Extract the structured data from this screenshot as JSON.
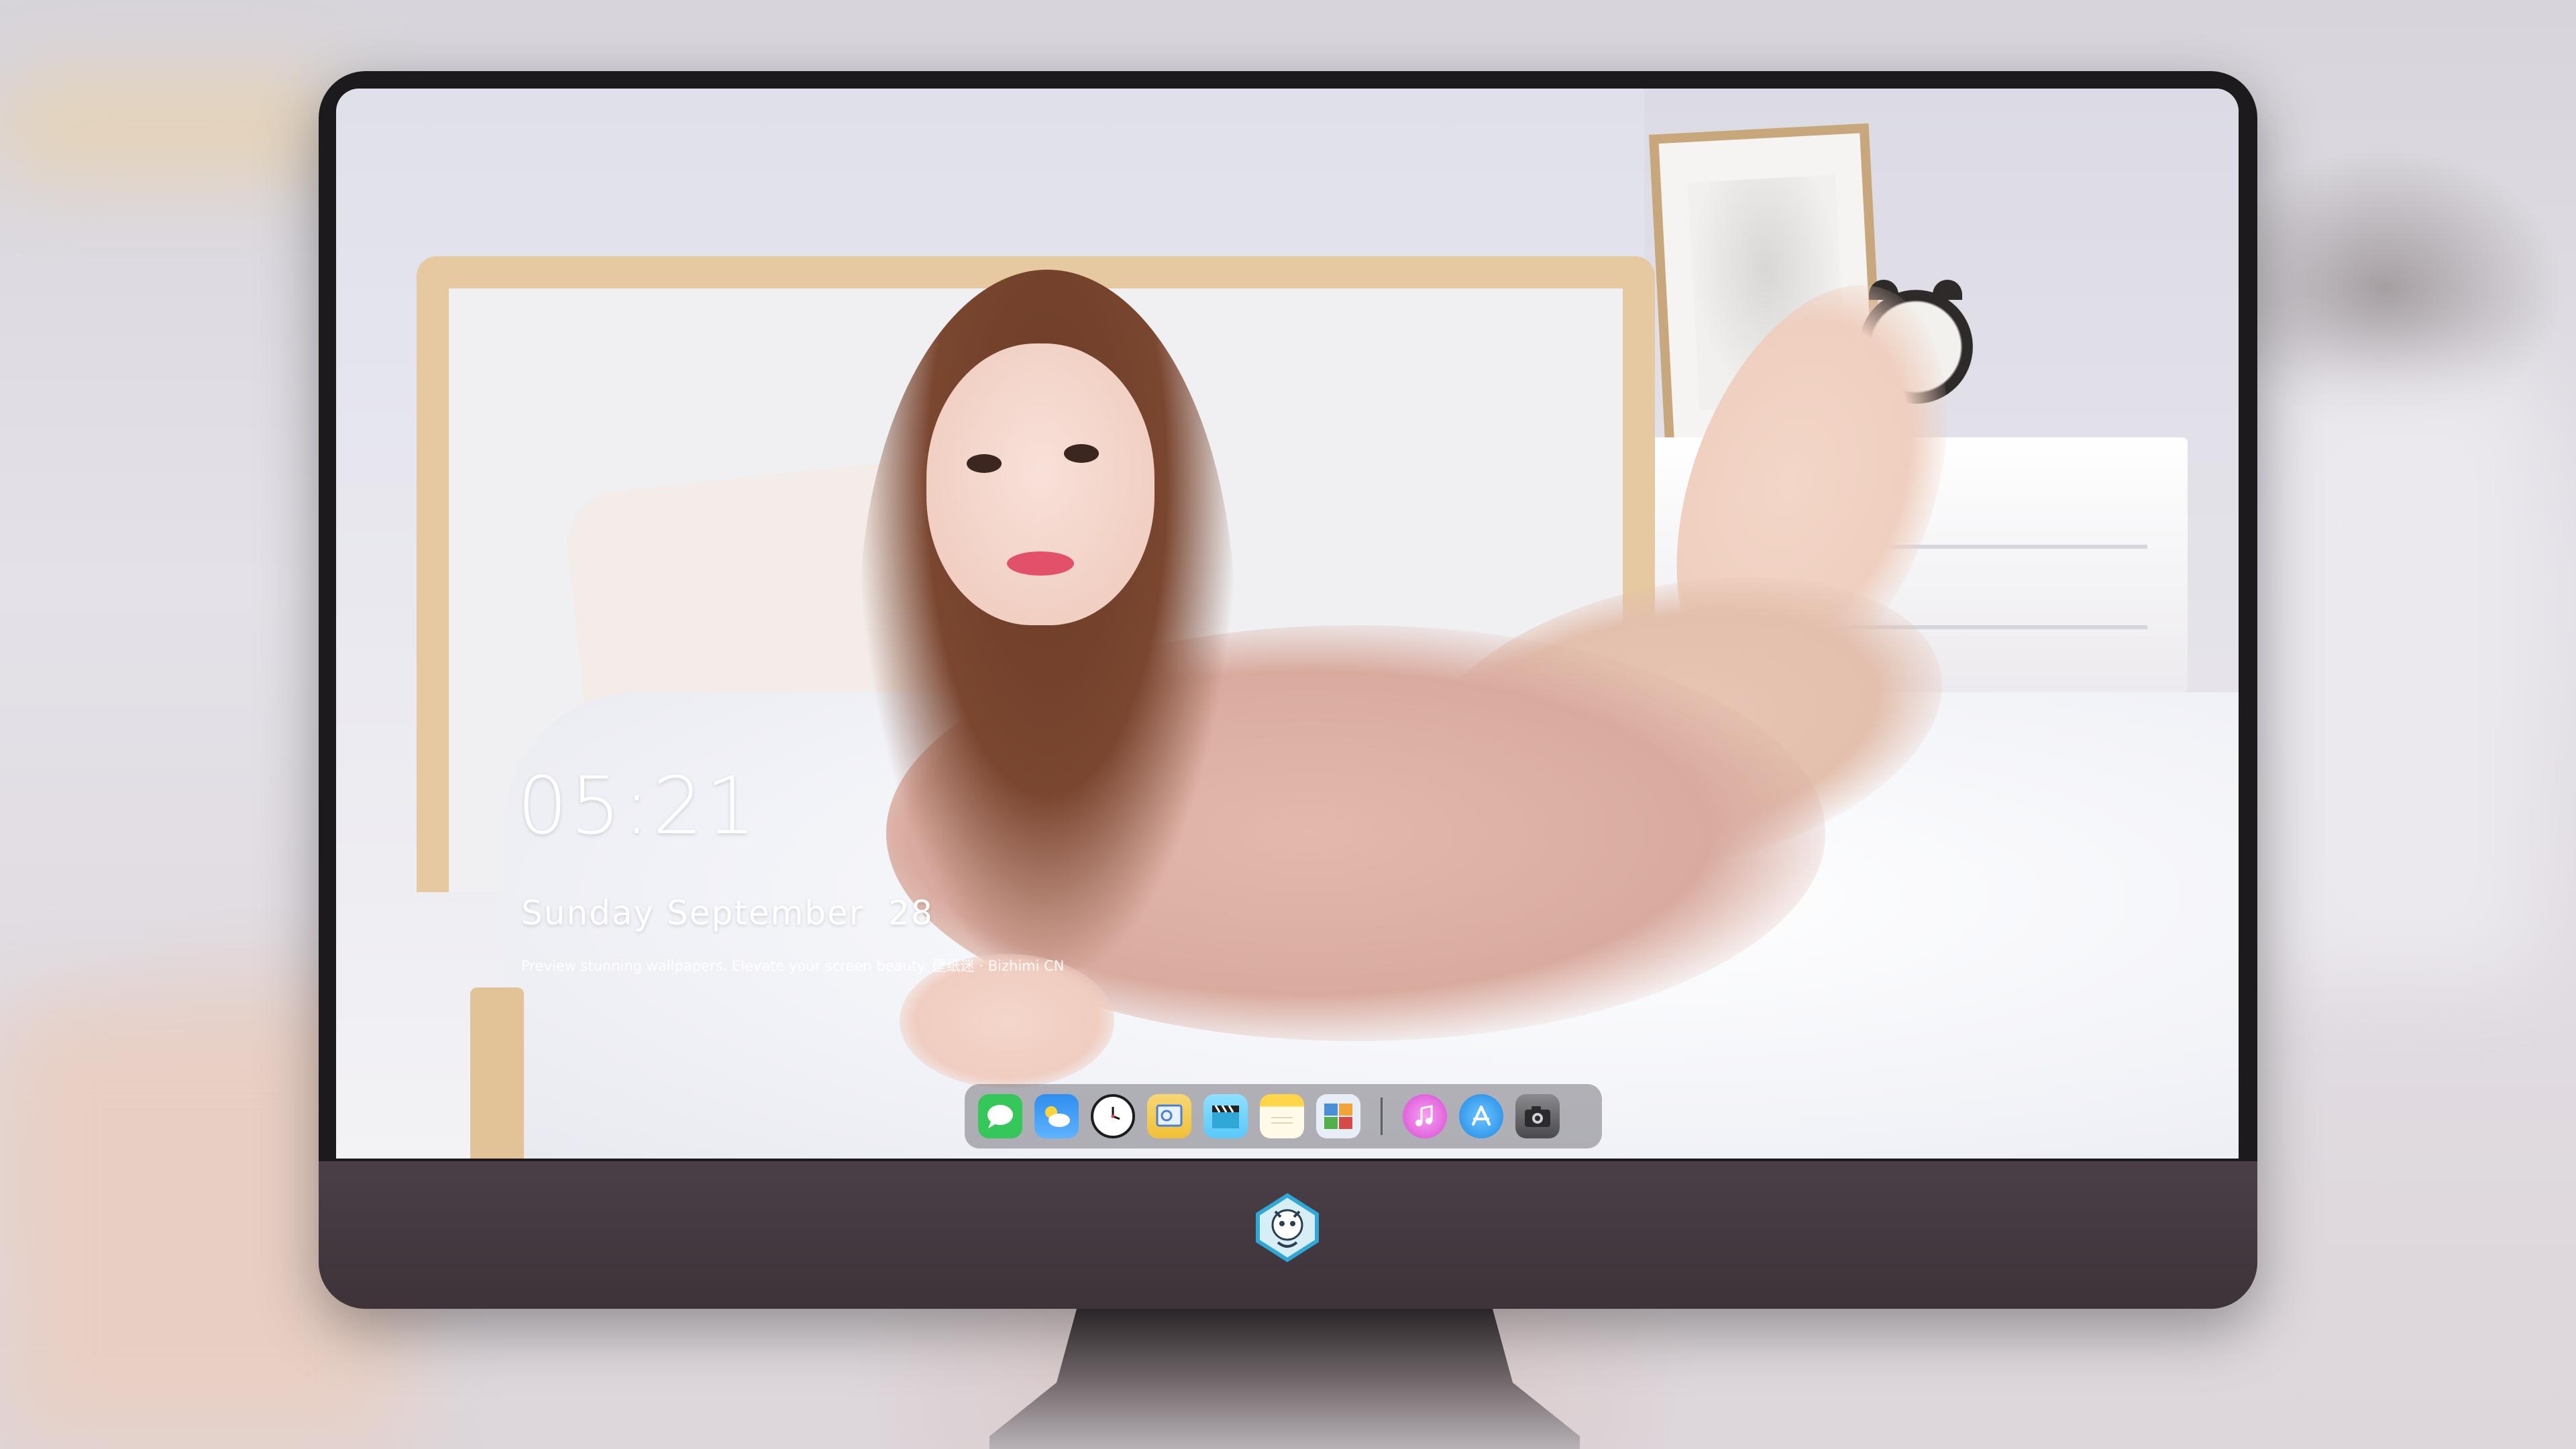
{
  "lock_screen": {
    "time": "05:21",
    "date": "Sunday September  28",
    "caption": "Preview stunning wallpapers. Elevate your screen beauty. 壁纸迷 · Bizhimi CN"
  },
  "dock": {
    "apps": [
      {
        "name": "messages-icon",
        "color": "#35c759"
      },
      {
        "name": "weather-icon",
        "color": "#2f8ef0"
      },
      {
        "name": "clock-icon",
        "color": "#1c1c1e"
      },
      {
        "name": "preview-icon",
        "color": "#f2c037"
      },
      {
        "name": "claquette-icon",
        "color": "#5ac8fa"
      },
      {
        "name": "notes-icon",
        "color": "#ffd54a"
      },
      {
        "name": "photo-browser-icon",
        "color": "#4a90d9"
      },
      {
        "name": "music-icon",
        "color": "#d94ad6"
      },
      {
        "name": "app-store-icon",
        "color": "#1e88e5"
      },
      {
        "name": "screenshot-icon",
        "color": "#4a4a4e"
      }
    ]
  }
}
